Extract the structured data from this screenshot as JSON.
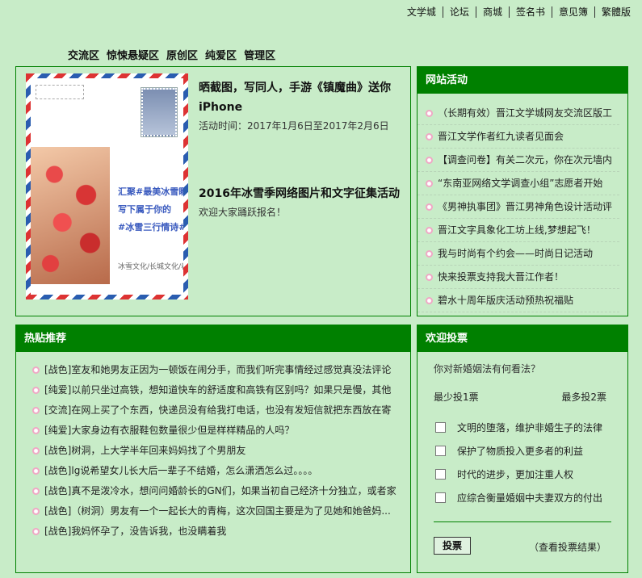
{
  "top_links": [
    "文学城",
    "论坛",
    "商城",
    "签名书",
    "意见簿",
    "繁體版"
  ],
  "zone_nav": [
    "交流区",
    "惊悚悬疑区",
    "原创区",
    "纯爱区",
    "管理区"
  ],
  "featured": {
    "postcard": {
      "handwriting": [
        "汇聚#最美冰雪瞬间#",
        "写下属于你的",
        "#冰雪三行情诗#"
      ],
      "sign": "冰雪文化/长城文化/春节文化"
    },
    "items": [
      {
        "title": "晒截图，写同人，手游《镇魔曲》送你iPhone",
        "desc": "活动时间：2017年1月6日至2017年2月6日"
      },
      {
        "title": "2016年冰雪季网络图片和文字征集活动",
        "desc": "欢迎大家踊跃报名！"
      }
    ]
  },
  "activity": {
    "title": "网站活动",
    "items": [
      "（长期有效）晋江文学城网友交流区版工",
      "晋江文学作者红九读者见面会",
      "【调查问卷】有关二次元，你在次元墙内",
      "“东南亚网络文学调查小组”志愿者开始",
      "《男神执事团》晋江男神角色设计活动评",
      "晋江文字具象化工坊上线,梦想起飞！",
      "我与时尚有个约会——时尚日记活动",
      "快来投票支持我大晋江作者！",
      "碧水十周年版庆活动预热祝福贴"
    ]
  },
  "hot": {
    "title": "热贴推荐",
    "items": [
      "[战色]室友和她男友正因为一顿饭在闹分手，而我们听完事情经过感觉真没法评论",
      "[纯爱]以前只坐过高铁，想知道快车的舒适度和高铁有区别吗？如果只是慢，其他",
      "[交流]在网上买了个东西，快递员没有给我打电话，也没有发短信就把东西放在寄",
      "[纯爱]大家身边有衣服鞋包数量很少但是样样精品的人吗？",
      "[战色]树洞，上大学半年回来妈妈找了个男朋友",
      "[战色]lg说希望女儿长大后一辈子不结婚，怎么潇洒怎么过。。。。",
      "[战色]真不是泼冷水，想问问婚龄长的GN们，如果当初自己经济十分独立，或者家",
      "[战色]（树洞）男友有一个一起长大的青梅，这次回国主要是为了见她和她爸妈...",
      "[战色]我妈怀孕了，没告诉我，也没瞒着我"
    ]
  },
  "vote": {
    "title": "欢迎投票",
    "question": "你对新婚姻法有何看法？",
    "min_label": "最少投1票",
    "max_label": "最多投2票",
    "options": [
      "文明的堕落，维护非婚生子的法律",
      "保护了物质投入更多者的利益",
      "时代的进步，更加注重人权",
      "应综合衡量婚姻中夫妻双方的付出"
    ],
    "submit_label": "投票",
    "result_label": "（查看投票结果）"
  }
}
